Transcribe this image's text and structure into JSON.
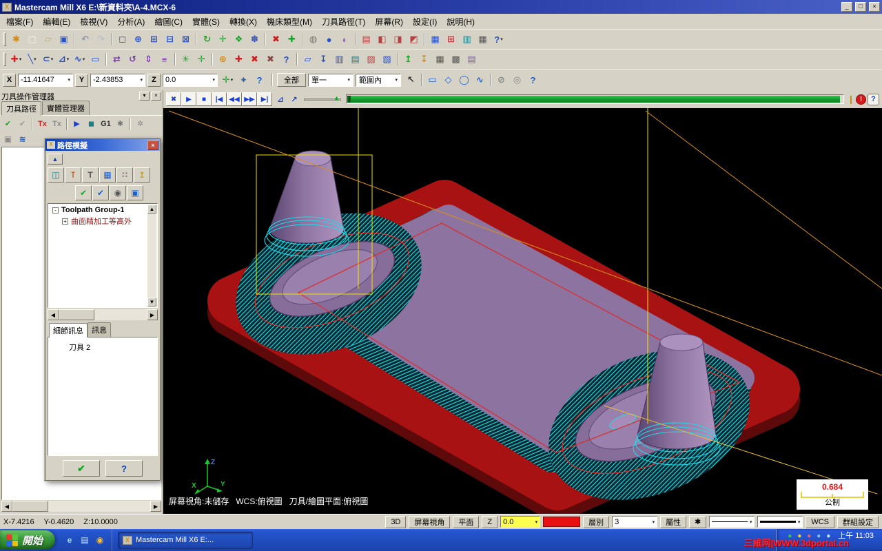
{
  "colors": {
    "stock-red": "#a81212",
    "part-purple": "#8d73a0",
    "toolpath-cyan": "#1cdcec",
    "wire-yellow": "#f5e400",
    "accent-blue": "#2850c8",
    "progress-green": "#18a830"
  },
  "ui": {
    "caret": "▾",
    "up": "▲",
    "down": "▼",
    "left": "◀",
    "right": "▶",
    "close": "×"
  },
  "window": {
    "title": "Mastercam Mill X6  E:\\新資料夾\\A-4.MCX-6",
    "app_icon_glyph": "X",
    "minimize": "_",
    "maximize": "□",
    "close": "×"
  },
  "menu": [
    "檔案(F)",
    "編輯(E)",
    "檢視(V)",
    "分析(A)",
    "繪圖(C)",
    "實體(S)",
    "轉換(X)",
    "機床類型(M)",
    "刀具路徑(T)",
    "屏幕(R)",
    "設定(I)",
    "說明(H)"
  ],
  "toolbar_main": [
    {
      "h": true
    },
    {
      "n": "analyze-config-icon",
      "g": "✱",
      "c": "#d88a10"
    },
    {
      "n": "new-file-icon",
      "g": "▢",
      "c": "#f8f6f0"
    },
    {
      "n": "open-file-icon",
      "g": "▱",
      "c": "#d8a828"
    },
    {
      "n": "save-file-icon",
      "g": "▣",
      "c": "#2850c8"
    },
    {
      "sep": true
    },
    {
      "n": "undo-icon",
      "g": "↶",
      "c": "#8a96a8"
    },
    {
      "n": "redo-icon",
      "g": "↷",
      "c": "#b8c0cc"
    },
    {
      "sep": true
    },
    {
      "n": "zoom-window-icon",
      "g": "◻",
      "c": "#2850c8"
    },
    {
      "n": "zoom-target-icon",
      "g": "⊕",
      "c": "#2850c8"
    },
    {
      "n": "zoom-in-icon",
      "g": "⊞",
      "c": "#2850c8"
    },
    {
      "n": "unzoom-icon",
      "g": "⊟",
      "c": "#2850c8"
    },
    {
      "n": "unzoom-80-icon",
      "g": "⊠",
      "c": "#2850c8"
    },
    {
      "sep": true
    },
    {
      "n": "dynamic-rotate-icon",
      "g": "↻",
      "c": "#18a428"
    },
    {
      "n": "pan-icon",
      "g": "✛",
      "c": "#18a428"
    },
    {
      "n": "fit-icon",
      "g": "❖",
      "c": "#18a428"
    },
    {
      "n": "repaint-icon",
      "g": "✽",
      "c": "#2850c8"
    },
    {
      "sep": true
    },
    {
      "n": "delete-entity-icon",
      "g": "✖",
      "c": "#cc2020"
    },
    {
      "n": "undelete-icon",
      "g": "✚",
      "c": "#18a428"
    },
    {
      "sep": true
    },
    {
      "n": "wireframe-display-icon",
      "g": "◍",
      "c": "#777777"
    },
    {
      "n": "shaded-display-icon",
      "g": "●",
      "c": "#2850c8"
    },
    {
      "n": "material-display-icon",
      "g": "◐",
      "c": "#8858b8"
    },
    {
      "sep": true
    },
    {
      "n": "gview-top-icon",
      "g": "▤",
      "c": "#b84040"
    },
    {
      "n": "gview-front-icon",
      "g": "◧",
      "c": "#b84040"
    },
    {
      "n": "gview-side-icon",
      "g": "◨",
      "c": "#b84040"
    },
    {
      "n": "gview-iso-icon",
      "g": "◩",
      "c": "#b84040"
    },
    {
      "sep": true
    },
    {
      "n": "planes-icon",
      "g": "▦",
      "c": "#2850c8"
    },
    {
      "n": "grid-settings-icon",
      "g": "⊞",
      "c": "#b84040"
    },
    {
      "n": "ram-saver-icon",
      "g": "▥",
      "c": "#18808a"
    },
    {
      "n": "calculator-icon",
      "g": "▦",
      "c": "#555555"
    },
    {
      "n": "toolbar-help-icon",
      "g": "?",
      "c": "#2850c8",
      "d": true
    }
  ],
  "toolbar_draw": [
    {
      "h": true
    },
    {
      "n": "create-point-icon",
      "g": "✚",
      "c": "#cc2020",
      "d": true
    },
    {
      "n": "create-line-icon",
      "g": "╲",
      "c": "#2850c8",
      "d": true
    },
    {
      "n": "create-arc-icon",
      "g": "⊂",
      "c": "#2850c8",
      "d": true
    },
    {
      "n": "create-fillet-icon",
      "g": "⊿",
      "c": "#2850c8",
      "d": true
    },
    {
      "n": "create-spline-icon",
      "g": "∿",
      "c": "#2850c8",
      "d": true
    },
    {
      "n": "create-rectangle-icon",
      "g": "▭",
      "c": "#2850c8"
    },
    {
      "sep": true
    },
    {
      "n": "xform-translate-icon",
      "g": "⇄",
      "c": "#7a40a8"
    },
    {
      "n": "xform-rotate-icon",
      "g": "↺",
      "c": "#7a40a8"
    },
    {
      "n": "xform-mirror-icon",
      "g": "⇕",
      "c": "#7a40a8"
    },
    {
      "n": "xform-offset-icon",
      "g": "≡",
      "c": "#7a40a8"
    },
    {
      "sep": true
    },
    {
      "n": "gnomon-icon",
      "g": "✳",
      "c": "#18a428"
    },
    {
      "n": "axes-toggle-icon",
      "g": "✛",
      "c": "#18a428"
    },
    {
      "sep": true
    },
    {
      "n": "trim-icon",
      "g": "⊕",
      "c": "#d88a10"
    },
    {
      "n": "break-icon",
      "g": "✚",
      "c": "#cc2020"
    },
    {
      "n": "delete-icon",
      "g": "✖",
      "c": "#cc2020"
    },
    {
      "n": "delete-duplicates-icon",
      "g": "✖",
      "c": "#8a4444"
    },
    {
      "n": "analyze-help-icon",
      "g": "?",
      "c": "#2850c8"
    },
    {
      "sep": true
    },
    {
      "n": "toolpath-contour-icon",
      "g": "▱",
      "c": "#2850c8"
    },
    {
      "n": "toolpath-drill-icon",
      "g": "↧",
      "c": "#2850c8"
    },
    {
      "n": "toolpath-pocket-icon",
      "g": "▥",
      "c": "#2850c8"
    },
    {
      "n": "toolpath-face-icon",
      "g": "▤",
      "c": "#18808a"
    },
    {
      "n": "surface-rough-icon",
      "g": "▨",
      "c": "#b84040"
    },
    {
      "n": "surface-finish-icon",
      "g": "▧",
      "c": "#2850c8"
    },
    {
      "sep": true
    },
    {
      "n": "z-analyze-icon",
      "g": "↥",
      "c": "#18a428"
    },
    {
      "n": "set-depth-icon",
      "g": "↧",
      "c": "#d88a10"
    },
    {
      "n": "machine-def-icon",
      "g": "▦",
      "c": "#555555"
    },
    {
      "n": "control-def-icon",
      "g": "▩",
      "c": "#555555"
    },
    {
      "n": "material-list-icon",
      "g": "▤",
      "c": "#8858b8"
    }
  ],
  "ribbon": {
    "x_label": "X",
    "x_value": "-11.41647",
    "y_label": "Y",
    "y_value": "-2.43853",
    "z_label": "Z",
    "z_value": "0.0",
    "left_icons": [
      {
        "n": "autocursor-icon",
        "g": "✛",
        "c": "#18a428",
        "d": true
      },
      {
        "n": "fastpoint-icon",
        "g": "⌖",
        "c": "#1a5fd0"
      },
      {
        "n": "cursor-help-icon",
        "g": "?",
        "c": "#1a5fd0"
      }
    ],
    "select_all": "全部",
    "select_single": "單一",
    "select_range": "範圍內",
    "select_icons": [
      {
        "n": "select-last-icon",
        "g": "↖",
        "c": "#333333"
      },
      {
        "sep": true
      },
      {
        "n": "select-window-icon",
        "g": "▭",
        "c": "#1a5fd0"
      },
      {
        "n": "select-polygon-icon",
        "g": "◇",
        "c": "#1a5fd0"
      },
      {
        "n": "select-area-icon",
        "g": "◯",
        "c": "#1a5fd0"
      },
      {
        "n": "select-vector-icon",
        "g": "∿",
        "c": "#1a5fd0"
      },
      {
        "sep": true
      },
      {
        "n": "select-invalid-icon",
        "g": "⊘",
        "c": "#888888"
      },
      {
        "n": "select-verify-icon",
        "g": "◎",
        "c": "#888888"
      },
      {
        "n": "selection-help-icon",
        "g": "?",
        "c": "#1a5fd0"
      }
    ]
  },
  "panel": {
    "title": "刀具操作管理器",
    "tab_toolpaths": "刀具路徑",
    "tab_solids": "實體管理器",
    "toolbar": [
      {
        "n": "select-all-operations-icon",
        "g": "✔",
        "c": "#18a428"
      },
      {
        "n": "regen-all-operations-icon",
        "g": "✔",
        "c": "#9a9a9a"
      },
      {
        "sep": true
      },
      {
        "n": "toolpath-lock-icon",
        "g": "Tx",
        "c": "#cc2020"
      },
      {
        "n": "toolpath-display-toggle-icon",
        "g": "Tx",
        "c": "#8a8a8a"
      },
      {
        "sep": true
      },
      {
        "n": "backplot-selected-icon",
        "g": "▶",
        "c": "#1a3fd0"
      },
      {
        "n": "verify-selected-icon",
        "g": "◼",
        "c": "#18808a"
      },
      {
        "n": "post-selected-icon",
        "g": "G1",
        "c": "#333333"
      },
      {
        "n": "high-feed-icon",
        "g": "✱",
        "c": "#777777"
      },
      {
        "sep": true
      },
      {
        "n": "options-gear-icon",
        "g": "✲",
        "c": "#888888"
      }
    ],
    "subbar": [
      {
        "n": "lock-panel-icon",
        "g": "▣",
        "c": "#8a8a8a"
      },
      {
        "n": "fluid-display-icon",
        "g": "≋",
        "c": "#1a5fd0"
      }
    ]
  },
  "dialog": {
    "title": "路徑模擬",
    "collapse_icon": "▲",
    "icons_row1": [
      {
        "n": "sim-colors-icon",
        "g": "◫",
        "c": "#18808a"
      },
      {
        "n": "show-tool-icon",
        "g": "⊺",
        "c": "#b05818"
      },
      {
        "n": "show-holder-icon",
        "g": "T",
        "c": "#555555"
      },
      {
        "n": "show-rapid-icon",
        "g": "▦",
        "c": "#1a5fd0"
      },
      {
        "n": "show-endpoints-icon",
        "g": "∷",
        "c": "#888888"
      },
      {
        "n": "restart-icon",
        "g": "↥",
        "c": "#c8a020"
      }
    ],
    "icons_row2": [
      {
        "n": "details-toggle-icon",
        "g": "✔",
        "c": "#18a428"
      },
      {
        "n": "info-toggle-icon",
        "g": "✔",
        "c": "#1a5fd0"
      },
      {
        "n": "snapshot-icon",
        "g": "◉",
        "c": "#555555"
      },
      {
        "n": "save-geometry-icon",
        "g": "▣",
        "c": "#1a5fd0"
      }
    ],
    "tree": [
      {
        "expander": "-",
        "label": "Toolpath Group-1"
      },
      {
        "expander": "+",
        "label": "曲面精加工等高外"
      }
    ],
    "tab_details": "細節訊息",
    "tab_info": "訊息",
    "info_text": "刀具 2",
    "ok_icon": "✔",
    "help_icon": "?"
  },
  "playback": {
    "buttons": [
      {
        "n": "backplot-close-icon",
        "g": "✖",
        "c": "#2040c0"
      },
      {
        "n": "play-icon",
        "g": "▶",
        "c": "#1a3fd0"
      },
      {
        "n": "stop-icon",
        "g": "■",
        "c": "#1a3fd0"
      },
      {
        "n": "go-start-icon",
        "g": "|◀",
        "c": "#1a3fd0"
      },
      {
        "n": "step-back-icon",
        "g": "◀◀",
        "c": "#1a3fd0"
      },
      {
        "n": "step-forward-icon",
        "g": "▶▶",
        "c": "#1a3fd0"
      },
      {
        "n": "go-end-icon",
        "g": "▶|",
        "c": "#1a3fd0"
      }
    ],
    "option_icons": [
      {
        "n": "trace-mode-icon",
        "g": "⊿",
        "c": "#1a3fd0"
      },
      {
        "n": "edit-path-icon",
        "g": "↗",
        "c": "#1a3fd0"
      }
    ],
    "lever_icon": "❙",
    "alert_icon": "!",
    "help_icon": "?"
  },
  "viewport": {
    "status_text": "屏幕視角:未儲存   WCS:俯視圖   刀具/繪圖平面:俯視圖",
    "gizmo": {
      "x": "X",
      "y": "Y",
      "z": "Z"
    },
    "scale_value": "0.684",
    "scale_unit": "公制"
  },
  "statusbar": {
    "coord_x": "X-7.4216",
    "coord_y": "Y-0.4620",
    "coord_z": "Z:10.0000",
    "mode_3d": "3D",
    "gview": "屏幕視角",
    "plane": "平面",
    "z_label": "Z",
    "z_value": "0.0",
    "layer_label": "層別",
    "layer_value": "3",
    "attributes": "屬性",
    "point_style": "✱",
    "wcs": "WCS",
    "groups": "群組設定"
  },
  "taskbar": {
    "start": "開始",
    "quick_launch": [
      {
        "n": "ie-icon",
        "g": "e",
        "c": "#9ad8f8"
      },
      {
        "n": "show-desktop-icon",
        "g": "▤",
        "c": "#bde0f8"
      },
      {
        "n": "media-player-icon",
        "g": "◉",
        "c": "#f8c040"
      }
    ],
    "task_label": "Mastercam Mill X6  E:...",
    "tray_icons": [
      {
        "n": "tray-antivirus-icon",
        "g": "●",
        "c": "#38c838"
      },
      {
        "n": "tray-qq-icon",
        "g": "●",
        "c": "#f8d020"
      },
      {
        "n": "tray-messenger-icon",
        "g": "●",
        "c": "#f06060"
      },
      {
        "n": "tray-volume-icon",
        "g": "●",
        "c": "#88c0f8"
      },
      {
        "n": "tray-network-icon",
        "g": "●",
        "c": "#c0e8f8"
      }
    ],
    "time": "上午 11:03"
  },
  "watermark": "三維网|WWW.3dportal.cn"
}
